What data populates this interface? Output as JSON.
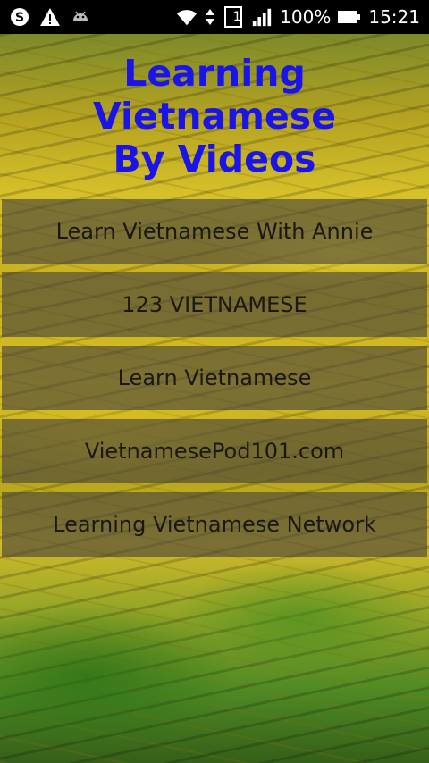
{
  "status_bar": {
    "battery_percent": "100%",
    "time": "15:21",
    "sim_slot": "1",
    "icons": [
      "skype-icon",
      "warning-icon",
      "android-icon",
      "wifi-icon",
      "data-arrows-icon",
      "sim-icon",
      "signal-icon",
      "battery-icon"
    ]
  },
  "app": {
    "title_line1": "Learning Vietnamese",
    "title_line2": "By Videos",
    "title_color": "#1a14e8"
  },
  "menu": {
    "items": [
      {
        "label": "Learn Vietnamese With Annie"
      },
      {
        "label": "123 VIETNAMESE"
      },
      {
        "label": "Learn Vietnamese"
      },
      {
        "label": "VietnamesePod101.com"
      },
      {
        "label": "Learning Vietnamese Network"
      }
    ]
  }
}
